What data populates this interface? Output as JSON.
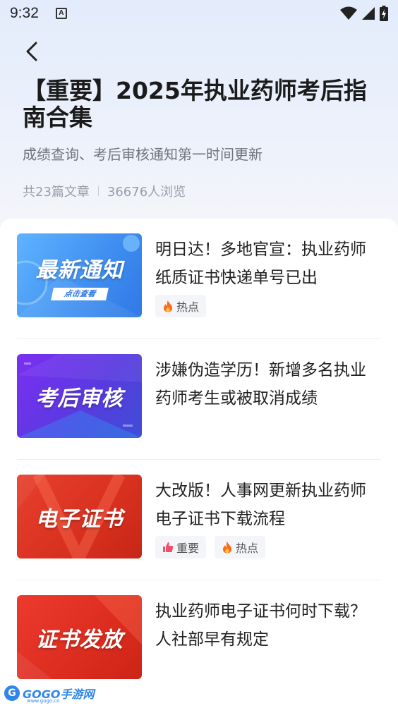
{
  "status_bar": {
    "time": "9:32",
    "a_badge": "A"
  },
  "header": {
    "title": "【重要】2025年执业药师考后指南合集",
    "subtitle": "成绩查询、考后审核通知第一时间更新",
    "article_count": "共23篇文章",
    "view_count": "36676人浏览"
  },
  "articles": [
    {
      "thumb_text": "最新通知",
      "thumb_sub": "点击查看",
      "title": "明日达！多地官宣：执业药师纸质证书快递单号已出",
      "tags": [
        {
          "icon": "fire-icon",
          "label": "热点"
        }
      ]
    },
    {
      "thumb_text": "考后审核",
      "title": "涉嫌伪造学历！新增多名执业药师考生或被取消成绩",
      "tags": []
    },
    {
      "thumb_text": "电子证书",
      "title": "大改版！人事网更新执业药师电子证书下载流程",
      "tags": [
        {
          "icon": "thumbs-up-icon",
          "label": "重要"
        },
        {
          "icon": "fire-icon",
          "label": "热点"
        }
      ]
    },
    {
      "thumb_text": "证书发放",
      "title": "执业药师电子证书何时下载？人社部早有规定",
      "tags": []
    }
  ],
  "colors": {
    "accent_blue": "#2f86e8",
    "fire": "#ff6a1a",
    "thumbs_up": "#f0506e"
  },
  "watermark": {
    "text": "GOGO手游网",
    "url": "www.gogo.cn"
  }
}
